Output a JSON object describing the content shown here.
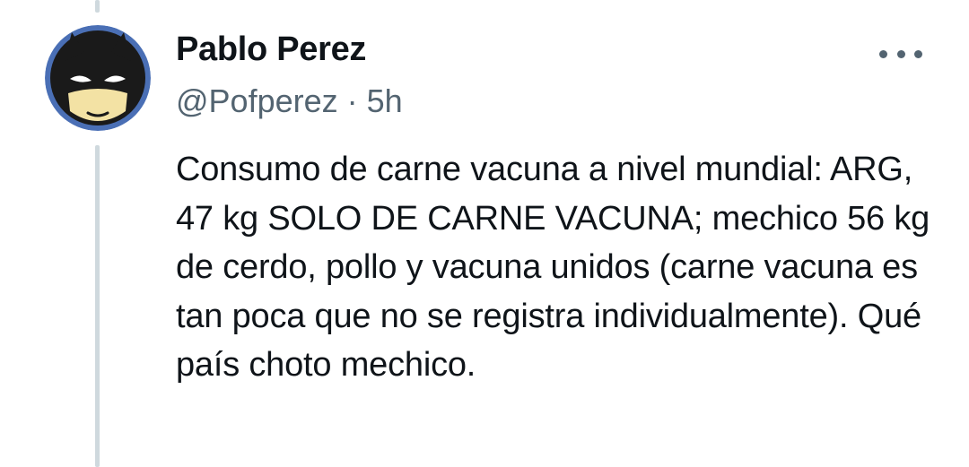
{
  "tweet": {
    "author": {
      "display_name": "Pablo Perez",
      "handle": "@Pofperez",
      "avatar_icon": "masked-hero-avatar"
    },
    "separator": "·",
    "timestamp": "5h",
    "text": "Consumo de carne vacuna a nivel mundial: ARG, 47 kg SOLO DE CARNE VACUNA; mechico 56 kg de cerdo, pollo y vacuna unidos (carne vacuna es tan poca que no se registra individualmente). Qué país choto mechico.",
    "more_icon": "more-horizontal-icon"
  },
  "colors": {
    "text_primary": "#0f1419",
    "text_secondary": "#536471",
    "thread_line": "#cfd9de",
    "avatar_bg": "#4a6fb5"
  }
}
